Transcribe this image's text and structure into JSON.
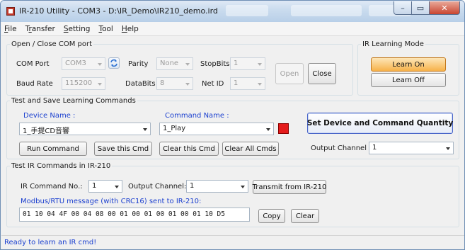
{
  "window": {
    "title": "IR-210 Utility - COM3 - D:\\IR_Demo\\IR210_demo.ird",
    "caption": {
      "min": "–",
      "max": "▭",
      "close": "✕"
    }
  },
  "menu": [
    {
      "hotkey": "F",
      "rest": "ile"
    },
    {
      "pre": "T",
      "hotkey": "r",
      "rest": "ansfer"
    },
    {
      "hotkey": "S",
      "rest": "etting"
    },
    {
      "hotkey": "T",
      "rest": "ool"
    },
    {
      "hotkey": "H",
      "rest": "elp"
    }
  ],
  "com_port_group": {
    "legend": "Open / Close COM port",
    "com_port_label": "COM Port",
    "com_port_value": "COM3",
    "parity_label": "Parity",
    "parity_value": "None",
    "stopbits_label": "StopBits",
    "stopbits_value": "1",
    "baud_rate_label": "Baud Rate",
    "baud_rate_value": "115200",
    "databits_label": "DataBits",
    "databits_value": "8",
    "net_id_label": "Net ID",
    "net_id_value": "1",
    "open_label": "Open",
    "close_label": "Close"
  },
  "learning_mode": {
    "legend": "IR Learning Mode",
    "learn_on_label": "Learn On",
    "learn_off_label": "Learn Off"
  },
  "test_save": {
    "legend": "Test and Save Learning Commands",
    "device_name_label": "Device Name :",
    "device_name_value": "1_手提CD音響",
    "command_name_label": "Command Name :",
    "command_name_value": "1_Play",
    "set_quantity_label": "Set Device and Command Quantity",
    "run_command_label": "Run Command",
    "save_cmd_label": "Save this Cmd",
    "clear_cmd_label": "Clear this Cmd",
    "clear_all_label": "Clear All Cmds",
    "output_channel_label": "Output Channel :",
    "output_channel_value": "1",
    "status_color": "#e51b1b"
  },
  "test_ir": {
    "legend": "Test IR Commands in IR-210",
    "ir_cmd_no_label": "IR Command No.:",
    "ir_cmd_no_value": "1",
    "output_channel_label": "Output Channel:",
    "output_channel_value": "1",
    "transmit_label": "Transmit from IR-210",
    "modbus_label": "Modbus/RTU message (with CRC16) sent to IR-210:",
    "modbus_value": "01 10 04 4F 00 04 08 00 01 00 01 00 01 00 01 10 D5",
    "copy_label": "Copy",
    "clear_label": "Clear"
  },
  "status_bar": {
    "text": "Ready to learn an IR cmd!"
  },
  "colors": {
    "accent_blue": "#1a3fcf",
    "learn_on": "#f7b24a",
    "indicator_red": "#e51b1b"
  }
}
